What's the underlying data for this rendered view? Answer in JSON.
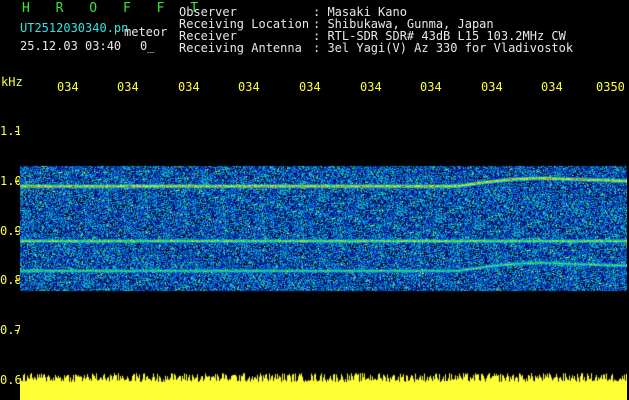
{
  "header": {
    "title": "H R O F F T",
    "filename": "UT2512030340.pn",
    "mode": "meteor",
    "timestamp": "25.12.03 03:40",
    "counter": "0_",
    "labels": [
      "Observer",
      "Receiving Location",
      "Receiver",
      "Receiving Antenna"
    ],
    "values": [
      ": Masaki Kano",
      ": Shibukawa, Gunma, Japan",
      ": RTL-SDR SDR# 43dB L15 103.2MHz CW",
      ": 3el Yagi(V) Az 330 for Vladivostok"
    ]
  },
  "axis": {
    "unit": "kHz",
    "y_ticks": [
      "1.1",
      "1.0",
      "0.9",
      "0.8",
      "0.7",
      "0.6"
    ],
    "x_ticks": [
      "034",
      "034",
      "034",
      "034",
      "034",
      "034",
      "034",
      "034",
      "034",
      "0350"
    ]
  },
  "colors": {
    "background": "#000000",
    "title": "#37e637",
    "filename": "#38e3e3",
    "header_text": "#e8e8e8",
    "axis": "#ffff33",
    "waterfall_low": "#0a1a8c",
    "waterfall_high": "#ff2a2a"
  },
  "spectrogram": {
    "bands_khz": [
      0.99,
      0.88,
      0.82
    ],
    "band_intensity": [
      0.95,
      0.8,
      0.7
    ],
    "noise_band_khz": [
      0.78,
      1.03
    ]
  }
}
